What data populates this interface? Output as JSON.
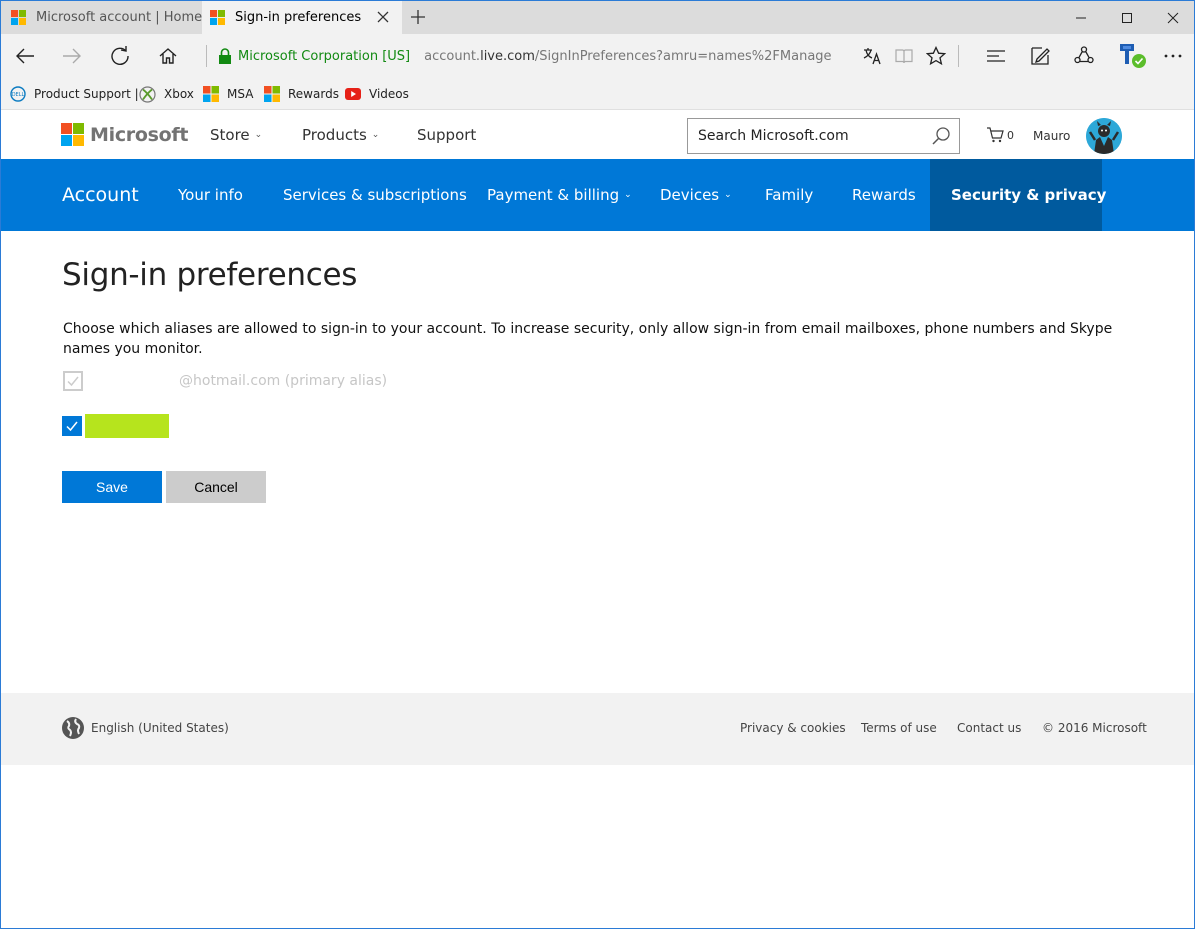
{
  "browser": {
    "tabs": [
      {
        "title": "Microsoft account | Home",
        "active": false
      },
      {
        "title": "Sign-in preferences",
        "active": true
      }
    ],
    "cert_org": "Microsoft Corporation [US]",
    "url_prefix": "account.",
    "url_domain": "live.com",
    "url_path": "/SignInPreferences?amru=names%2FManage",
    "favorites": [
      {
        "label": "Product Support |",
        "icon": "dell-icon"
      },
      {
        "label": "Xbox",
        "icon": "xbox-icon"
      },
      {
        "label": "MSA",
        "icon": "microsoft-logo-icon"
      },
      {
        "label": "Rewards",
        "icon": "microsoft-logo-icon"
      },
      {
        "label": "Videos",
        "icon": "youtube-icon"
      }
    ]
  },
  "header": {
    "brand": "Microsoft",
    "nav": {
      "store": "Store",
      "products": "Products",
      "support": "Support"
    },
    "search_placeholder": "Search Microsoft.com",
    "cart_count": "0",
    "user_name": "Mauro"
  },
  "account_nav": {
    "brand": "Account",
    "items": [
      "Your info",
      "Services & subscriptions",
      "Payment & billing",
      "Devices",
      "Family",
      "Rewards",
      "Security & privacy"
    ],
    "active": "Security & privacy"
  },
  "main": {
    "title": "Sign-in preferences",
    "description": "Choose which aliases are allowed to sign-in to your account. To increase security, only allow sign-in from email mailboxes, phone numbers and Skype names you monitor.",
    "primary_alias_suffix": "@hotmail.com (primary alias)",
    "save_label": "Save",
    "cancel_label": "Cancel"
  },
  "footer": {
    "locale": "English (United States)",
    "privacy": "Privacy & cookies",
    "terms": "Terms of use",
    "contact": "Contact us",
    "copyright": "© 2016 Microsoft"
  },
  "colors": {
    "accent": "#0078d7",
    "accent_dark": "#005a9e",
    "secure_green": "#128a12",
    "redaction": "#b6e41d"
  }
}
